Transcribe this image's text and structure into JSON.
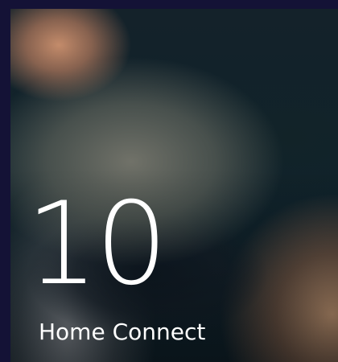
{
  "tile": {
    "number": "10",
    "label": "Home Connect"
  },
  "colors": {
    "background": "#141236",
    "text": "#ffffff"
  }
}
